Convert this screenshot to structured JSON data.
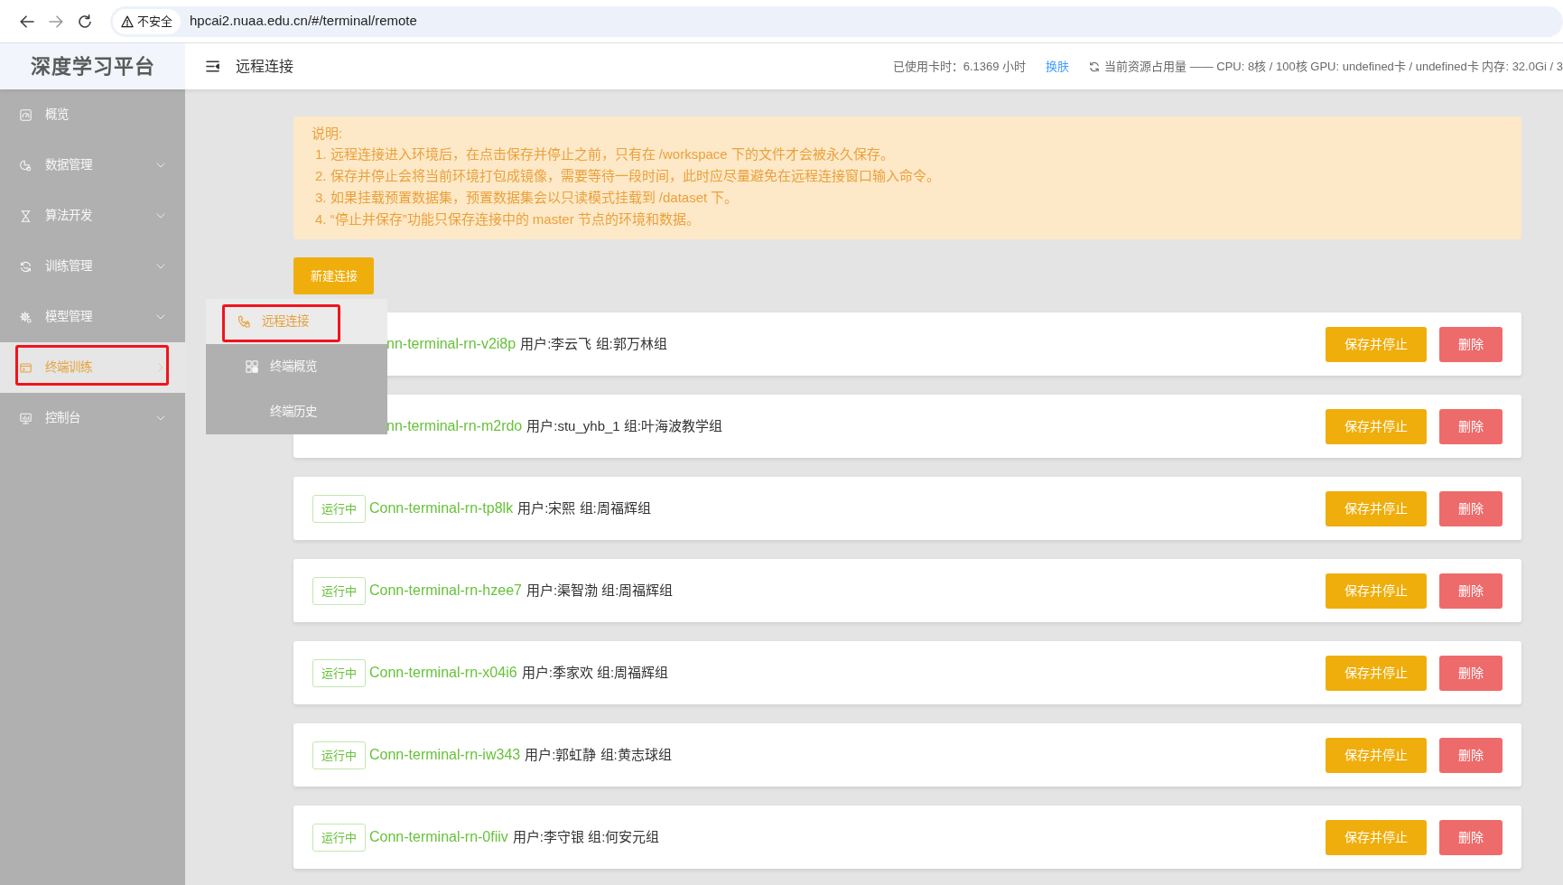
{
  "browser": {
    "security_label": "不安全",
    "url": "hpcai2.nuaa.edu.cn/#/terminal/remote"
  },
  "header": {
    "logo": "深度学习平台",
    "page_title": "远程连接",
    "card_hours": "已使用卡时：6.1369 小时",
    "theme_link": "换肤",
    "resource_usage": "当前资源占用量 —— CPU: 8核 / 100核 GPU: undefined卡 / undefined卡 内存: 32.0Gi / 3"
  },
  "sidebar": {
    "items": [
      {
        "label": "概览",
        "kind": "link",
        "selected": false,
        "highlighted": false
      },
      {
        "label": "数据管理",
        "kind": "menu",
        "selected": false,
        "open": false,
        "highlighted": false
      },
      {
        "label": "算法开发",
        "kind": "menu",
        "selected": false,
        "open": false,
        "highlighted": false
      },
      {
        "label": "训练管理",
        "kind": "menu",
        "selected": false,
        "open": false,
        "highlighted": false
      },
      {
        "label": "模型管理",
        "kind": "menu",
        "selected": false,
        "open": false,
        "highlighted": false
      },
      {
        "label": "终端训练",
        "kind": "menu",
        "selected": true,
        "open": true,
        "highlighted": true,
        "children": [
          {
            "label": "远程连接",
            "selected": true,
            "highlighted": true
          },
          {
            "label": "终端概览",
            "selected": false,
            "highlighted": false
          },
          {
            "label": "终端历史",
            "selected": false,
            "highlighted": false
          }
        ]
      },
      {
        "label": "控制台",
        "kind": "menu",
        "selected": false,
        "open": false,
        "highlighted": false
      }
    ]
  },
  "notice": {
    "title": "说明:",
    "lines": [
      "1. 远程连接进入环境后，在点击保存并停止之前，只有在 /workspace 下的文件才会被永久保存。",
      "2. 保存并停止会将当前环境打包成镜像，需要等待一段时间，此时应尽量避免在远程连接窗口输入命令。",
      "3. 如果挂载预置数据集，预置数据集会以只读模式挂载到 /dataset 下。",
      "4. “停止并保存”功能只保存连接中的 master 节点的环境和数据。"
    ]
  },
  "new_button": "新建连接",
  "connections": [
    {
      "name": "nn-terminal-rn-v2i8p",
      "info": "用户:李云飞 组:郭万林组",
      "save_button": "保存并停止",
      "delete_button": "删除"
    },
    {
      "name": "nn-terminal-rn-m2rdo",
      "info": "用户:stu_yhb_1 组:叶海波教学组",
      "save_button": "保存并停止",
      "delete_button": "删除"
    },
    {
      "status": "运行中",
      "name": "Conn-terminal-rn-tp8lk",
      "info": "用户:宋熙 组:周福辉组",
      "save_button": "保存并停止",
      "delete_button": "删除"
    },
    {
      "status": "运行中",
      "name": "Conn-terminal-rn-hzee7",
      "info": "用户:渠智渤 组:周福辉组",
      "save_button": "保存并停止",
      "delete_button": "删除"
    },
    {
      "status": "运行中",
      "name": "Conn-terminal-rn-x04i6",
      "info": "用户:季家欢 组:周福辉组",
      "save_button": "保存并停止",
      "delete_button": "删除"
    },
    {
      "status": "运行中",
      "name": "Conn-terminal-rn-iw343",
      "info": "用户:郭虹静 组:黄志球组",
      "save_button": "保存并停止",
      "delete_button": "删除"
    },
    {
      "status": "运行中",
      "name": "Conn-terminal-rn-0fiiv",
      "info": "用户:李守银 组:何安元组",
      "save_button": "保存并停止",
      "delete_button": "删除"
    }
  ]
}
